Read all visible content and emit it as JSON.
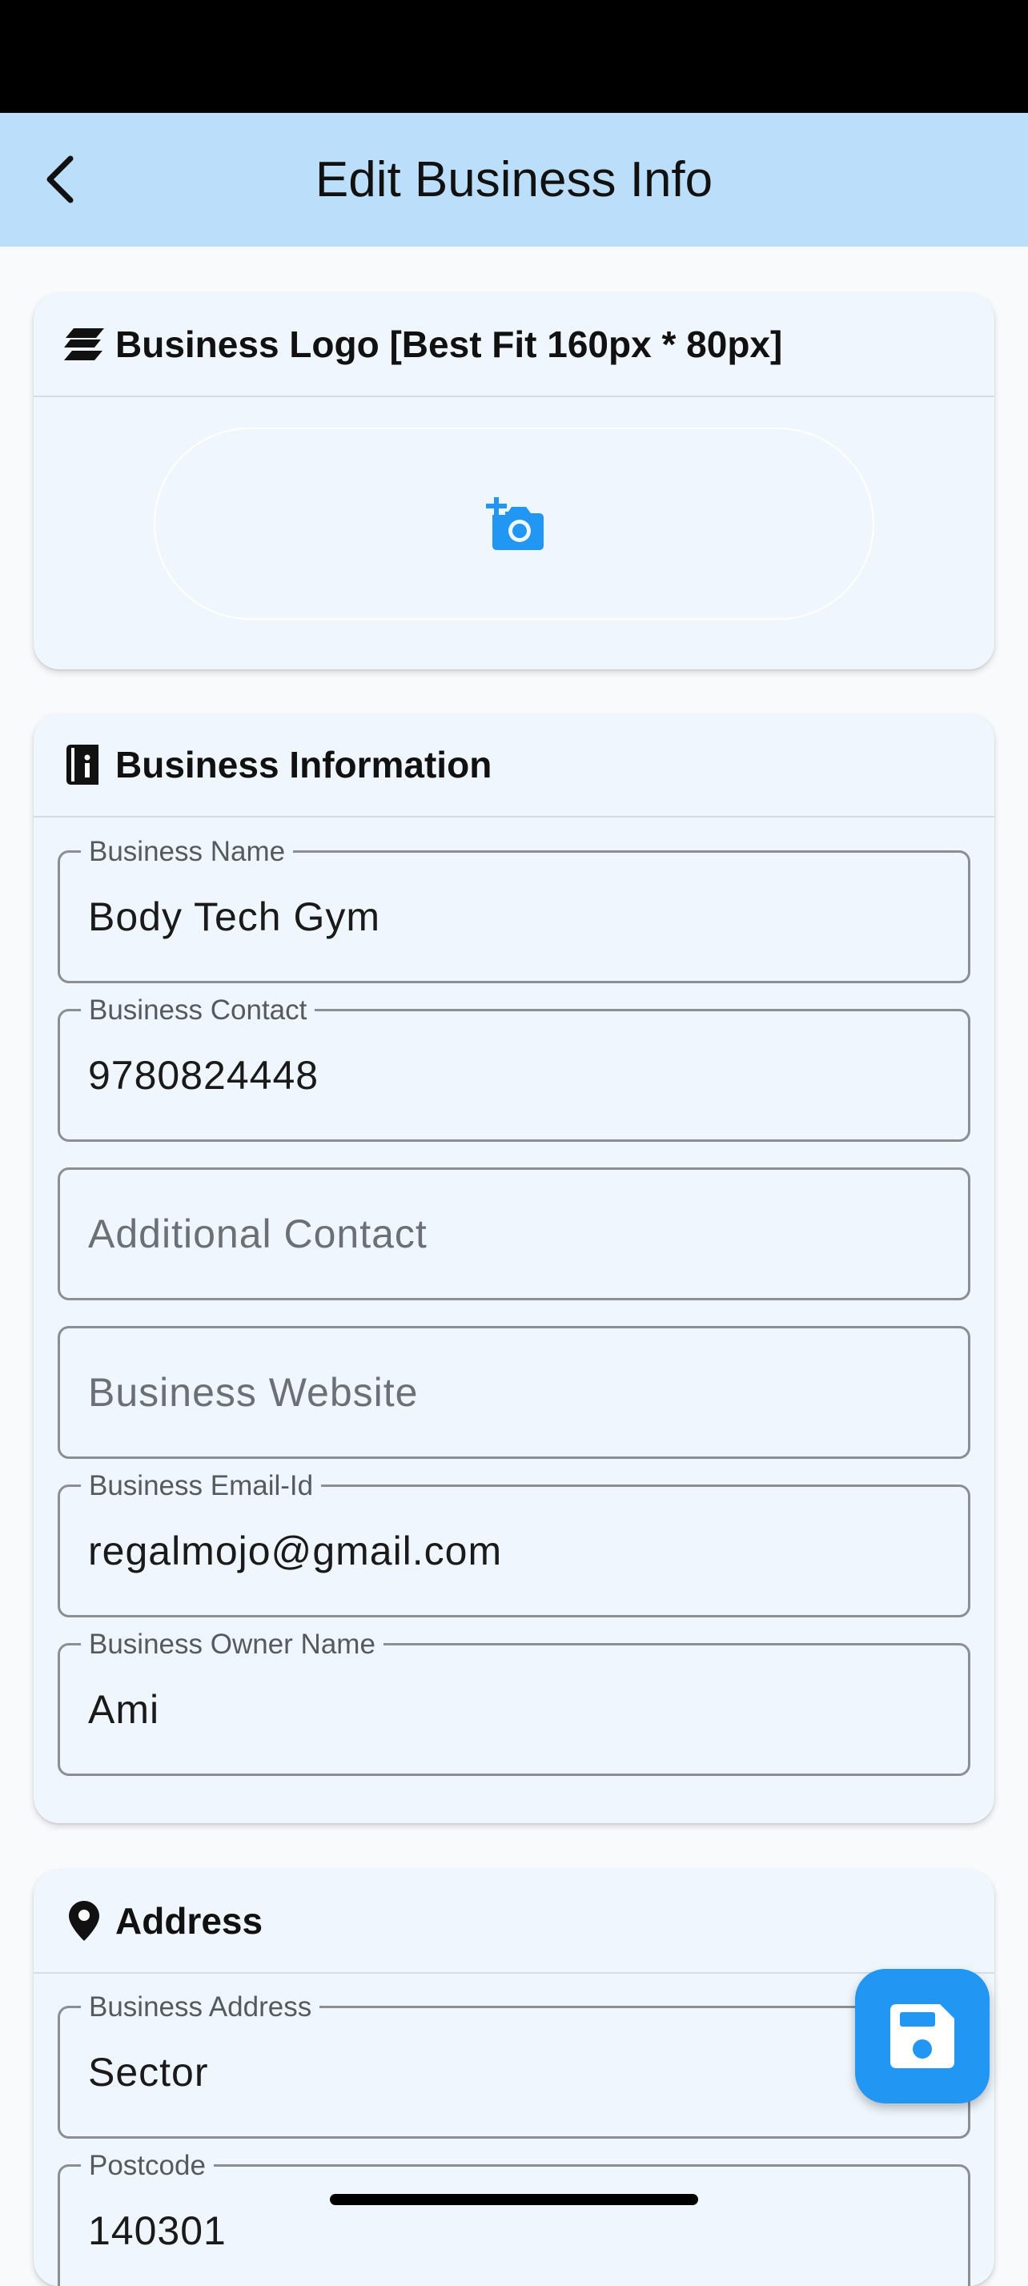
{
  "app_bar": {
    "title": "Edit Business Info",
    "back_icon": "chevron-left-icon"
  },
  "logo_card": {
    "title": "Business Logo [Best Fit 160px * 80px]",
    "header_icon": "layers-icon",
    "upload_icon": "add-photo-icon"
  },
  "info_card": {
    "title": "Business Information",
    "header_icon": "info-book-icon",
    "fields": {
      "name": {
        "label": "Business Name",
        "value": "Body Tech Gym"
      },
      "contact": {
        "label": "Business Contact",
        "value": "9780824448"
      },
      "additional_contact": {
        "placeholder": "Additional Contact"
      },
      "website": {
        "placeholder": "Business Website"
      },
      "email": {
        "label": "Business Email-Id",
        "value": "regalmojo@gmail.com"
      },
      "owner": {
        "label": "Business Owner Name",
        "value": "Ami"
      }
    }
  },
  "address_card": {
    "title": "Address",
    "header_icon": "location-pin-icon",
    "fields": {
      "address": {
        "label": "Business Address",
        "value": "Sector"
      },
      "postcode": {
        "label": "Postcode",
        "value": "140301"
      }
    }
  },
  "fab": {
    "icon": "save-icon"
  },
  "colors": {
    "app_bar": "#bbdefb",
    "accent": "#2196f3",
    "card_bg": "#eff6fe",
    "page_bg": "#f8fafc"
  }
}
